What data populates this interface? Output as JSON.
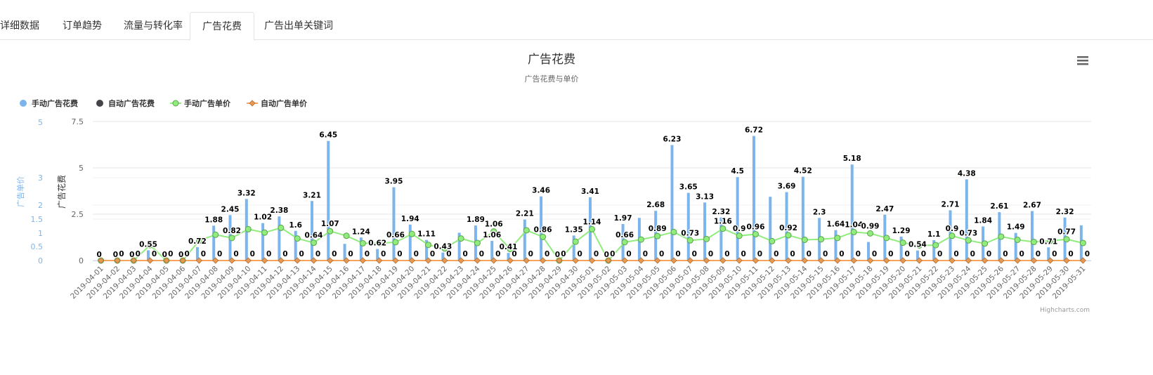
{
  "tabs": [
    {
      "label": "详细数据",
      "active": false
    },
    {
      "label": "订单趋势",
      "active": false
    },
    {
      "label": "流量与转化率",
      "active": false
    },
    {
      "label": "广告花费",
      "active": true
    },
    {
      "label": "广告出单关键词",
      "active": false
    }
  ],
  "menu_icon": "hamburger-menu-icon",
  "credit": "Highcharts.com",
  "colors": {
    "manual_spend": "#7cb5ec",
    "auto_spend": "#434348",
    "manual_price": "#90ed7d",
    "auto_price": "#f7a35c",
    "axis_label": "#7cb5ec"
  },
  "chart_data": {
    "type": "bar",
    "title": "广告花费",
    "subtitle": "广告花费与单价",
    "ylabel_left_outer": "广告单价",
    "ylabel_left_inner": "广告花费",
    "ylim_spend": [
      0,
      7.5
    ],
    "spend_ticks": [
      "0",
      "2.5",
      "5",
      "7.5"
    ],
    "ylim_price": [
      0,
      5
    ],
    "price_ticks": [
      "0",
      "0.5",
      "1",
      "1.5",
      "2",
      "3",
      "5"
    ],
    "legend_position": "top-left",
    "grid": true,
    "categories": [
      "2019-04-01",
      "2019-04-02",
      "2019-04-03",
      "2019-04-04",
      "2019-04-05",
      "2019-04-06",
      "2019-04-07",
      "2019-04-08",
      "2019-04-09",
      "2019-04-10",
      "2019-04-11",
      "2019-04-12",
      "2019-04-13",
      "2019-04-14",
      "2019-04-15",
      "2019-04-16",
      "2019-04-17",
      "2019-04-18",
      "2019-04-19",
      "2019-04-20",
      "2019-04-21",
      "2019-04-22",
      "2019-04-23",
      "2019-04-24",
      "2019-04-25",
      "2019-04-26",
      "2019-04-27",
      "2019-04-28",
      "2019-04-29",
      "2019-04-30",
      "2019-05-01",
      "2019-05-02",
      "2019-05-03",
      "2019-05-04",
      "2019-05-05",
      "2019-05-06",
      "2019-05-07",
      "2019-05-08",
      "2019-05-09",
      "2019-05-10",
      "2019-05-11",
      "2019-05-12",
      "2019-05-13",
      "2019-05-14",
      "2019-05-15",
      "2019-05-16",
      "2019-05-17",
      "2019-05-18",
      "2019-05-19",
      "2019-05-20",
      "2019-05-21",
      "2019-05-22",
      "2019-05-23",
      "2019-05-24",
      "2019-05-25",
      "2019-05-26",
      "2019-05-27",
      "2019-05-28",
      "2019-05-29",
      "2019-05-30",
      "2019-05-31"
    ],
    "series": [
      {
        "name": "手动广告花费",
        "kind": "column",
        "axis": "spend",
        "values": [
          0,
          0,
          0,
          0.55,
          0,
          0,
          0.72,
          1.88,
          2.45,
          3.32,
          2.02,
          2.38,
          1.6,
          3.21,
          6.45,
          0.9,
          1.24,
          0.62,
          3.95,
          1.94,
          1.11,
          0.43,
          1.5,
          1.89,
          1.06,
          0.41,
          2.21,
          3.46,
          0,
          1.35,
          3.41,
          0,
          1.97,
          2.3,
          2.68,
          6.23,
          3.65,
          3.13,
          2.32,
          4.5,
          6.72,
          3.44,
          3.69,
          4.52,
          2.3,
          1.64,
          5.18,
          1.0,
          2.47,
          1.29,
          0.54,
          1.1,
          2.71,
          4.38,
          1.84,
          2.61,
          1.49,
          2.67,
          0.71,
          2.32,
          1.9
        ],
        "labels": [
          "0",
          "0",
          "0",
          "0.55",
          "0",
          "0",
          "0.72",
          "1.88",
          "2.45",
          "3.32",
          "1.02",
          "2.38",
          "1.6",
          "3.21",
          "6.45",
          "",
          "1.24",
          "0.62",
          "3.95",
          "1.94",
          "1.11",
          "0.43",
          "",
          "1.89",
          "1.06",
          "0.41",
          "2.21",
          "3.46",
          "0",
          "1.35",
          "3.41",
          "0",
          "1.97",
          "",
          "2.68",
          "6.23",
          "3.65",
          "3.13",
          "2.32",
          "4.5",
          "6.72",
          "",
          "3.69",
          "4.52",
          "2.3",
          "1.64",
          "5.18",
          "",
          "2.47",
          "1.29",
          "0.54",
          "1.1",
          "2.71",
          "4.38",
          "1.84",
          "2.61",
          "1.49",
          "2.67",
          "0.71",
          "2.32",
          ""
        ]
      },
      {
        "name": "自动广告花费",
        "kind": "column",
        "axis": "spend",
        "values": [
          0,
          0,
          0,
          0,
          0,
          0,
          0,
          0,
          0,
          0,
          0,
          0,
          0,
          0,
          0,
          0,
          0,
          0,
          0,
          0,
          0,
          0,
          0,
          0,
          0,
          0,
          0,
          0,
          0,
          0,
          0,
          0,
          0,
          0,
          0,
          0,
          0,
          0,
          0,
          0,
          0,
          0,
          0,
          0,
          0,
          0,
          0,
          0,
          0,
          0,
          0,
          0,
          0,
          0,
          0,
          0,
          0,
          0,
          0,
          0,
          0
        ],
        "labels": [
          "",
          "0",
          "0",
          "0",
          "0",
          "0",
          "0",
          "0",
          "0",
          "0",
          "0",
          "0",
          "0",
          "0",
          "0",
          "0",
          "0",
          "0",
          "0",
          "0",
          "0",
          "0",
          "0",
          "0",
          "0",
          "0",
          "0",
          "0",
          "0",
          "0",
          "0",
          "0",
          "0",
          "0",
          "0",
          "0",
          "0",
          "0",
          "0",
          "0",
          "0",
          "0",
          "0",
          "0",
          "0",
          "0",
          "0",
          "0",
          "0",
          "0",
          "0",
          "0",
          "0",
          "0",
          "0",
          "0",
          "0",
          "0",
          "0",
          "0",
          "0"
        ]
      },
      {
        "name": "手动广告单价",
        "kind": "line",
        "axis": "price",
        "values": [
          0,
          0,
          0,
          0.55,
          0,
          0,
          0.72,
          0.94,
          0.82,
          1.14,
          1.02,
          1.19,
          0.8,
          0.64,
          1.07,
          0.9,
          0.62,
          0.62,
          0.66,
          0.97,
          0.56,
          0.43,
          0.8,
          0.63,
          1.06,
          0.41,
          1.1,
          0.86,
          0,
          0.68,
          1.14,
          0,
          0.66,
          0.76,
          0.89,
          1.04,
          0.73,
          0.78,
          1.16,
          0.9,
          0.96,
          0.7,
          0.92,
          0.75,
          0.77,
          0.82,
          1.04,
          0.99,
          0.82,
          0.64,
          0.54,
          0.55,
          0.9,
          0.73,
          0.61,
          0.87,
          0.75,
          0.67,
          0.71,
          0.77,
          0.63
        ],
        "labels": [
          "",
          "",
          "",
          "",
          "",
          "",
          "",
          "",
          "0.82",
          "",
          "",
          "",
          "",
          "0.64",
          "1.07",
          "",
          "",
          "",
          "0.66",
          "",
          "",
          "",
          "",
          "",
          "1.06",
          "",
          "",
          "0.86",
          "",
          "",
          "1.14",
          "",
          "0.66",
          "",
          "0.89",
          "",
          "0.73",
          "",
          "1.16",
          "0.9",
          "0.96",
          "",
          "0.92",
          "",
          "",
          "",
          "1.04",
          "0.99",
          "",
          "",
          "",
          "",
          "0.9",
          "0.73",
          "",
          "",
          "",
          "",
          "",
          "0.77",
          ""
        ]
      },
      {
        "name": "自动广告单价",
        "kind": "line",
        "axis": "price",
        "values": [
          0,
          0,
          0,
          0,
          0,
          0,
          0,
          0,
          0,
          0,
          0,
          0,
          0,
          0,
          0,
          0,
          0,
          0,
          0,
          0,
          0,
          0,
          0,
          0,
          0,
          0,
          0,
          0,
          0,
          0,
          0,
          0,
          0,
          0,
          0,
          0,
          0,
          0,
          0,
          0,
          0,
          0,
          0,
          0,
          0,
          0,
          0,
          0,
          0,
          0,
          0,
          0,
          0,
          0,
          0,
          0,
          0,
          0,
          0,
          0,
          0
        ]
      }
    ]
  }
}
